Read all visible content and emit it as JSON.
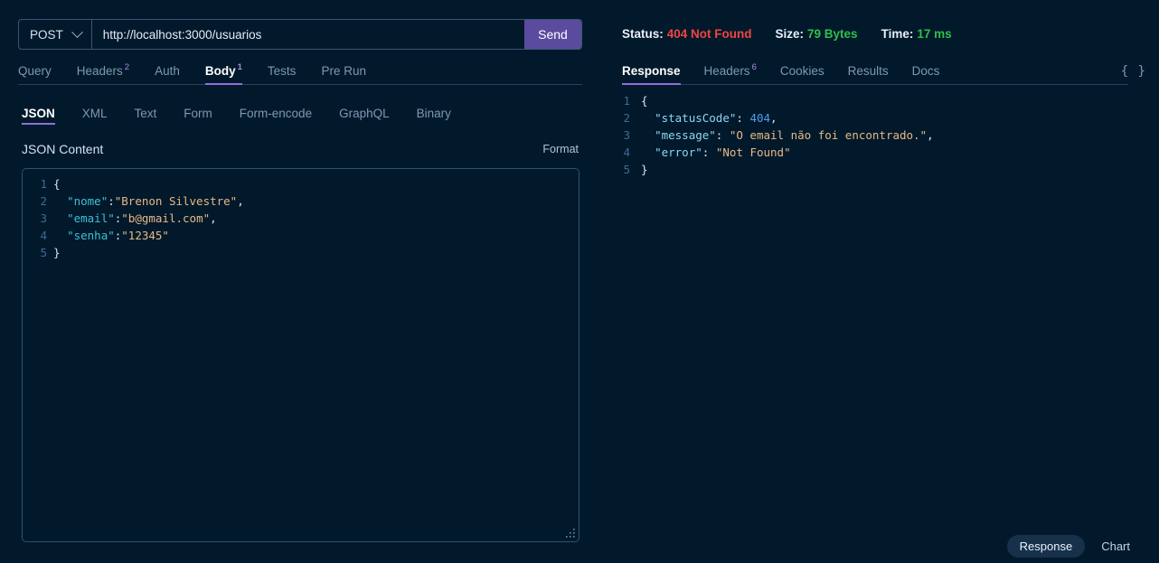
{
  "request": {
    "method": "POST",
    "method_icon": "chevron-down-icon",
    "url": "http://localhost:3000/usuarios",
    "url_placeholder": "Enter URL",
    "send_label": "Send",
    "tabs": [
      {
        "label": "Query",
        "badge": "",
        "active": false
      },
      {
        "label": "Headers",
        "badge": "2",
        "active": false
      },
      {
        "label": "Auth",
        "badge": "",
        "active": false
      },
      {
        "label": "Body",
        "badge": "1",
        "active": true
      },
      {
        "label": "Tests",
        "badge": "",
        "active": false
      },
      {
        "label": "Pre Run",
        "badge": "",
        "active": false
      }
    ],
    "body_tabs": [
      {
        "label": "JSON",
        "active": true
      },
      {
        "label": "XML",
        "active": false
      },
      {
        "label": "Text",
        "active": false
      },
      {
        "label": "Form",
        "active": false
      },
      {
        "label": "Form-encode",
        "active": false
      },
      {
        "label": "GraphQL",
        "active": false
      },
      {
        "label": "Binary",
        "active": false
      }
    ],
    "content_label": "JSON Content",
    "format_label": "Format",
    "editor_lines": [
      {
        "n": "1",
        "tokens": [
          {
            "t": "{",
            "c": "tok-punc"
          }
        ]
      },
      {
        "n": "2",
        "tokens": [
          {
            "t": "  ",
            "c": "tok-punc"
          },
          {
            "t": "\"nome\"",
            "c": "tok-key"
          },
          {
            "t": ":",
            "c": "tok-punc"
          },
          {
            "t": "\"Brenon Silvestre\"",
            "c": "tok-str"
          },
          {
            "t": ",",
            "c": "tok-punc"
          }
        ]
      },
      {
        "n": "3",
        "tokens": [
          {
            "t": "  ",
            "c": "tok-punc"
          },
          {
            "t": "\"email\"",
            "c": "tok-key"
          },
          {
            "t": ":",
            "c": "tok-punc"
          },
          {
            "t": "\"b@gmail.com\"",
            "c": "tok-str"
          },
          {
            "t": ",",
            "c": "tok-punc"
          }
        ]
      },
      {
        "n": "4",
        "tokens": [
          {
            "t": "  ",
            "c": "tok-punc"
          },
          {
            "t": "\"senha\"",
            "c": "tok-key"
          },
          {
            "t": ":",
            "c": "tok-punc"
          },
          {
            "t": "\"12345\"",
            "c": "tok-str"
          }
        ]
      },
      {
        "n": "5",
        "tokens": [
          {
            "t": "}",
            "c": "tok-punc"
          }
        ]
      }
    ]
  },
  "response": {
    "status_label": "Status:",
    "status_value": "404 Not Found",
    "size_label": "Size:",
    "size_value": "79 Bytes",
    "time_label": "Time:",
    "time_value": "17 ms",
    "status_color": "#f0453f",
    "ok_color": "#2fbf4b",
    "tabs": [
      {
        "label": "Response",
        "badge": "",
        "active": true
      },
      {
        "label": "Headers",
        "badge": "6",
        "active": false
      },
      {
        "label": "Cookies",
        "badge": "",
        "active": false
      },
      {
        "label": "Results",
        "badge": "",
        "active": false
      },
      {
        "label": "Docs",
        "badge": "",
        "active": false
      }
    ],
    "json_icon_label": "{ }",
    "body_lines": [
      {
        "n": "1",
        "tokens": [
          {
            "t": "{",
            "c": "tok-punc"
          }
        ]
      },
      {
        "n": "2",
        "tokens": [
          {
            "t": "  ",
            "c": "tok-punc"
          },
          {
            "t": "\"statusCode\"",
            "c": "tok-key2"
          },
          {
            "t": ": ",
            "c": "tok-punc"
          },
          {
            "t": "404",
            "c": "tok-num"
          },
          {
            "t": ",",
            "c": "tok-punc"
          }
        ]
      },
      {
        "n": "3",
        "tokens": [
          {
            "t": "  ",
            "c": "tok-punc"
          },
          {
            "t": "\"message\"",
            "c": "tok-key2"
          },
          {
            "t": ": ",
            "c": "tok-punc"
          },
          {
            "t": "\"O email não foi encontrado.\"",
            "c": "tok-str"
          },
          {
            "t": ",",
            "c": "tok-punc"
          }
        ]
      },
      {
        "n": "4",
        "tokens": [
          {
            "t": "  ",
            "c": "tok-punc"
          },
          {
            "t": "\"error\"",
            "c": "tok-key2"
          },
          {
            "t": ": ",
            "c": "tok-punc"
          },
          {
            "t": "\"Not Found\"",
            "c": "tok-str"
          }
        ]
      },
      {
        "n": "5",
        "tokens": [
          {
            "t": "}",
            "c": "tok-punc"
          }
        ]
      }
    ],
    "view_toggle": [
      {
        "label": "Response",
        "active": true
      },
      {
        "label": "Chart",
        "active": false
      }
    ]
  },
  "theme": {
    "background": "#02192c",
    "accent": "#8f6fd8",
    "send_button": "#5b4b9e",
    "border": "#32506c"
  }
}
